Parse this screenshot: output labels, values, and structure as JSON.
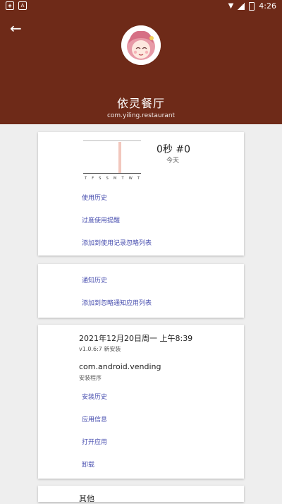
{
  "status_bar": {
    "time": "4:26",
    "icons": [
      "shield-icon",
      "a-icon",
      "wifi-icon",
      "signal-icon",
      "battery-icon"
    ]
  },
  "header": {
    "back_icon": "arrow-left-icon",
    "app_name": "依灵餐厅",
    "package_name": "com.yiling.restaurant",
    "background_color": "#6e2a18"
  },
  "usage_card": {
    "usage_value": "0秒 #0",
    "usage_period": "今天",
    "weekday_labels": [
      "T",
      "F",
      "S",
      "S",
      "M",
      "T",
      "W",
      "T"
    ],
    "links": [
      "使用历史",
      "过度使用提醒",
      "添加到使用记录忽略列表"
    ]
  },
  "notification_card": {
    "links": [
      "通知历史",
      "添加到忽略通知应用列表"
    ]
  },
  "install_card": {
    "install_date": "2021年12月20日周一 上午8:39",
    "version_status": "v1.0.6:7 新安装",
    "installer_package": "com.android.vending",
    "installer_label": "安装程序",
    "links": [
      "安装历史",
      "应用信息",
      "打开应用",
      "卸载"
    ]
  },
  "other_card": {
    "title": "其他"
  },
  "colors": {
    "link": "#4a50b0",
    "background": "#eeeeee"
  }
}
